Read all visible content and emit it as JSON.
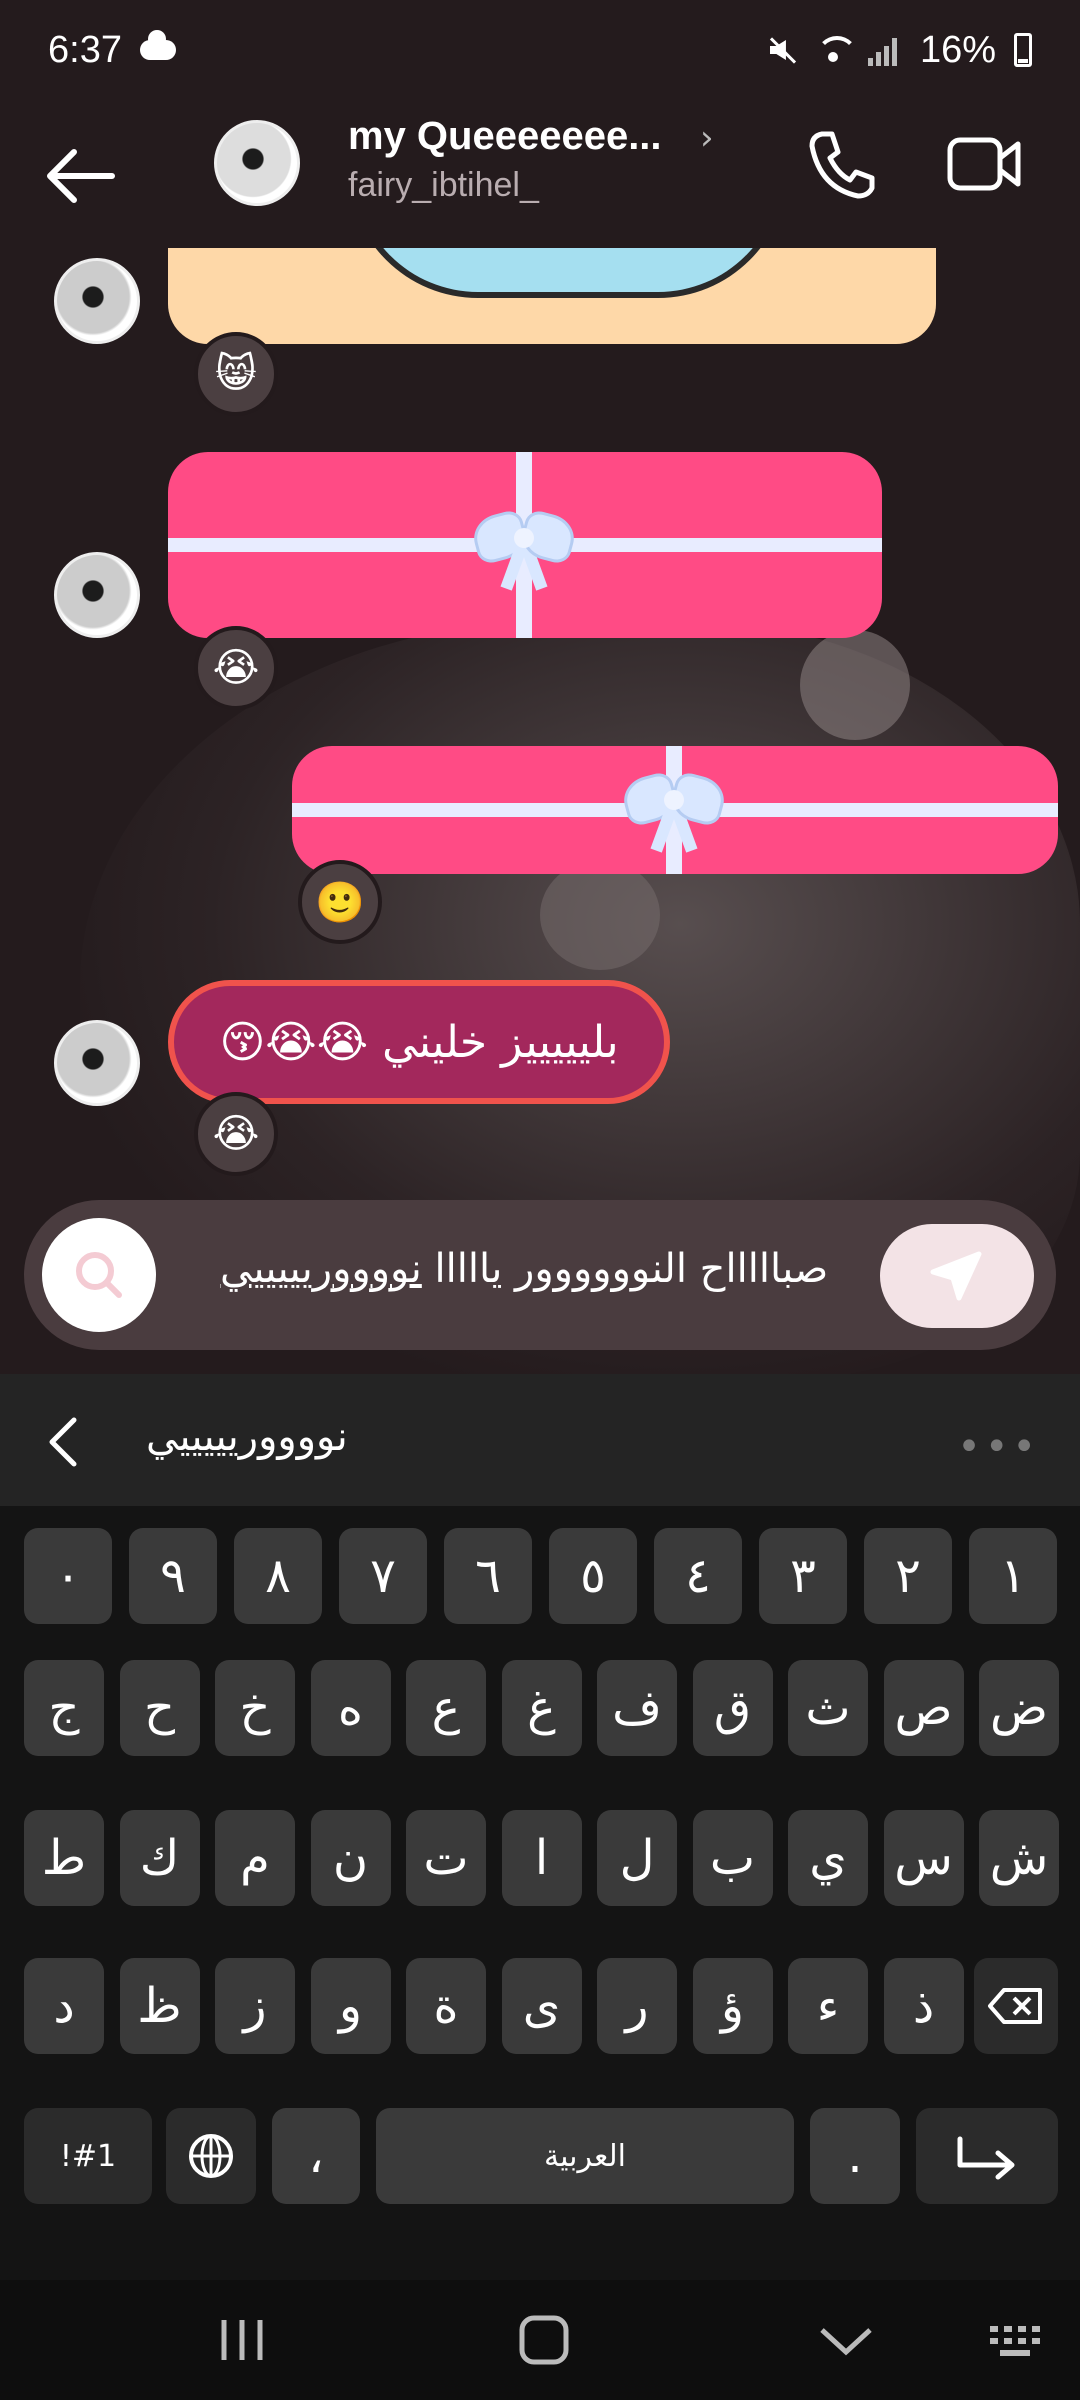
{
  "status_bar": {
    "time": "6:37",
    "battery": "16%"
  },
  "header": {
    "name": "my Queeeeeee...",
    "username": "fairy_ibtihel_"
  },
  "messages": {
    "reaction_1": "😸",
    "reaction_2": "😭",
    "reaction_3": "🙂",
    "text_message": "بليييييز خليني 😭😭😚",
    "reaction_4": "😭"
  },
  "composer": {
    "text_main": "صباااااح النوووووور يااااا",
    "text_underlined": "نووووريييييي"
  },
  "keyboard": {
    "suggestion": "نووووريييييي",
    "row_numbers": [
      "١",
      "٢",
      "٣",
      "٤",
      "٥",
      "٦",
      "٧",
      "٨",
      "٩",
      "٠"
    ],
    "row_1": [
      "ض",
      "ص",
      "ث",
      "ق",
      "ف",
      "غ",
      "ع",
      "ه",
      "خ",
      "ح",
      "ج"
    ],
    "row_2": [
      "ش",
      "س",
      "ي",
      "ب",
      "ل",
      "ا",
      "ت",
      "ن",
      "م",
      "ك",
      "ط"
    ],
    "row_3": [
      "ذ",
      "ء",
      "ؤ",
      "ر",
      "ى",
      "ة",
      "و",
      "ز",
      "ظ",
      "د"
    ],
    "symbols_label": "!#1",
    "comma_label": "،",
    "space_label": "العربية",
    "period_label": "."
  },
  "colors": {
    "accent": "#ff4b85",
    "bubble": "#a3285c",
    "bubble_border": "#f0534c"
  }
}
